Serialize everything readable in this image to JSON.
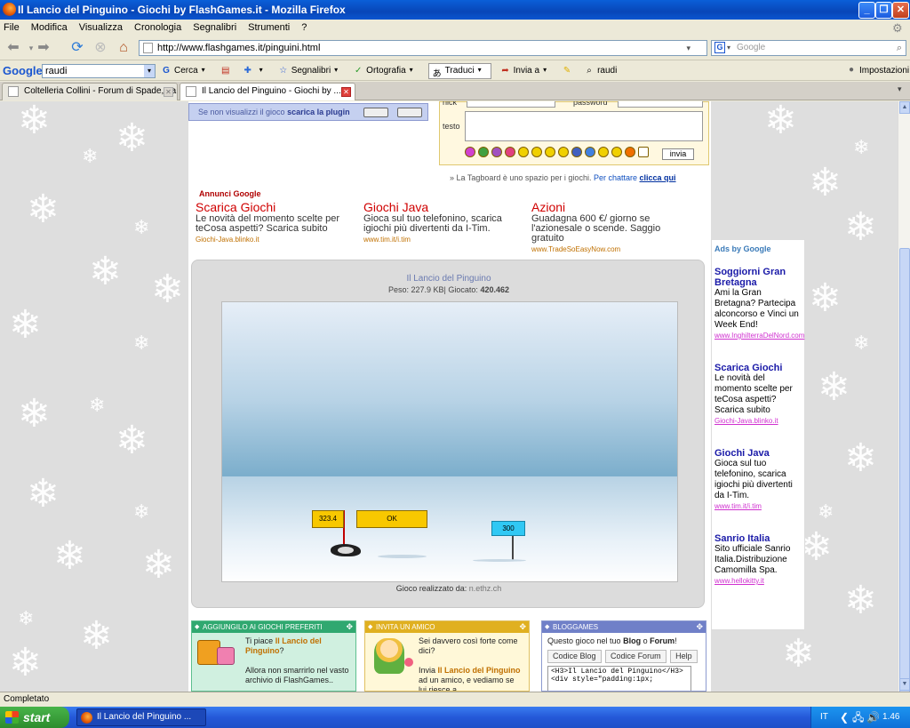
{
  "window": {
    "title": "Il Lancio del Pinguino - Giochi by FlashGames.it - Mozilla Firefox"
  },
  "menu": [
    "File",
    "Modifica",
    "Visualizza",
    "Cronologia",
    "Segnalibri",
    "Strumenti",
    "?"
  ],
  "nav": {
    "url": "http://www.flashgames.it/pinguini.html",
    "search_placeholder": "Google"
  },
  "google_toolbar": {
    "logo": "Google",
    "query": "raudi",
    "items": [
      "Cerca",
      "Segnalibri",
      "Ortografia",
      "Traduci",
      "Invia a",
      "raudi"
    ],
    "settings": "Impostazioni"
  },
  "tabs": [
    {
      "label": "Coltelleria Collini - Forum di Spade, La...",
      "active": false
    },
    {
      "label": "Il Lancio del Pinguino - Giochi by ...",
      "active": true
    }
  ],
  "page": {
    "plugin_notice": "Se non visualizzi il gioco",
    "plugin_link": "scarica la plugin",
    "tagboard": {
      "label_nick": "nick",
      "label_password": "password",
      "label_text": "testo",
      "submit": "invia"
    },
    "tag_note": "» La Tagboard è uno spazio per i giochi.",
    "tag_chat": "Per chattare",
    "tag_chat_link": "clicca qui",
    "ads_label": "Annunci Google",
    "ads": [
      {
        "title": "Scarica Giochi",
        "text": "Le novità del momento scelte per teCosa aspetti? Scarica subito",
        "url": "Giochi-Java.blinko.it"
      },
      {
        "title": "Giochi Java",
        "text": "Gioca sul tuo telefonino, scarica igiochi più divertenti da I-Tim.",
        "url": "www.tim.it/i.tim"
      },
      {
        "title": "Azioni",
        "text": "Guadagna 600 €/ giorno se l'azionesale o scende. Saggio gratuito",
        "url": "www.TradeSoEasyNow.com"
      }
    ],
    "game": {
      "title": "Il Lancio del Pinguino",
      "meta_prefix": "Peso: 227.9 KB| Giocato:",
      "plays": "420.462",
      "marker_distance": "323.4",
      "ok_label": "OK",
      "target_marker": "300",
      "credit_label": "Gioco realizzato da:",
      "credit_author": "n.ethz.ch"
    },
    "panels": [
      {
        "header": "AGGIUNGILO AI GIOCHI PREFERITI",
        "line1": "Ti piace",
        "game": "Il Lancio del Pinguino",
        "q": "?",
        "line2": "Allora non smarrirlo nel vasto archivio di FlashGames.."
      },
      {
        "header": "INVITA UN AMICO",
        "line1": "Sei davvero così forte come dici?",
        "line2": "Invia",
        "game": "Il Lancio del Pinguino",
        "line3": "ad un amico, e vediamo se lui riesce a"
      },
      {
        "header": "BLOGGAMES",
        "intro_a": "Questo gioco nel tuo",
        "blog": "Blog",
        "o": "o",
        "forum": "Forum",
        "excl": "!",
        "tabs": [
          "Codice Blog",
          "Codice Forum",
          "Help"
        ],
        "code": "<H3>Il Lancio del Pinguino</H3> <div style=\"padding:1px;"
      }
    ],
    "right_ads": {
      "header": "Ads by Google",
      "items": [
        {
          "title": "Soggiorni Gran Bretagna",
          "text": "Ami la Gran Bretagna? Partecipa alconcorso e Vinci un Week End!",
          "url": "www.InghilterraDelNord.com"
        },
        {
          "title": "Scarica Giochi",
          "text": "Le novità del momento scelte per teCosa aspetti? Scarica subito",
          "url": "Giochi-Java.blinko.it"
        },
        {
          "title": "Giochi Java",
          "text": "Gioca sul tuo telefonino, scarica igiochi più divertenti da I-Tim.",
          "url": "www.tim.it/i.tim"
        },
        {
          "title": "Sanrio Italia",
          "text": "Sito ufficiale Sanrio Italia.Distribuzione Camomilla Spa.",
          "url": "www.hellokitty.it"
        }
      ]
    }
  },
  "status": "Completato",
  "taskbar": {
    "start": "start",
    "item": "Il Lancio del Pinguino ...",
    "lang": "IT",
    "clock": "1.46"
  }
}
